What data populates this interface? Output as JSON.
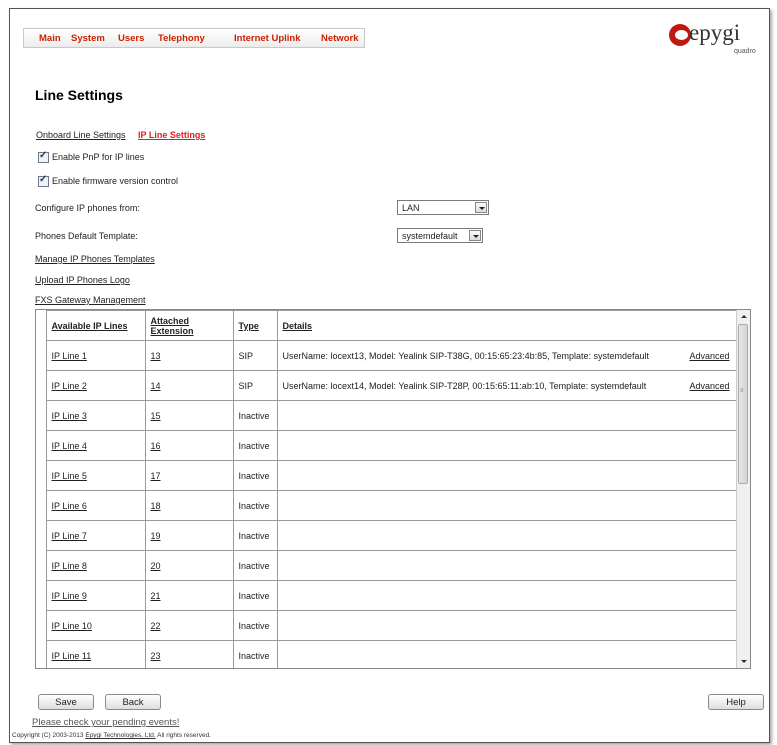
{
  "nav": {
    "items": [
      "Main",
      "System",
      "Users",
      "Telephony",
      "Internet Uplink",
      "Network"
    ]
  },
  "logo": {
    "word": "epygi",
    "sub": "quadro"
  },
  "page_title": "Line Settings",
  "subnav": {
    "onboard": "Onboard Line Settings",
    "ip": "IP Line Settings"
  },
  "checkboxes": {
    "pnp": "Enable PnP for IP lines",
    "firmware": "Enable firmware version control"
  },
  "configure": {
    "label": "Configure IP phones from:",
    "value": "LAN"
  },
  "template": {
    "label": "Phones Default Template:",
    "value": "systemdefault"
  },
  "links": {
    "manage": "Manage IP Phones Templates",
    "upload": "Upload IP Phones Logo",
    "fxs": "FXS Gateway Management"
  },
  "table": {
    "headers": [
      "Available IP Lines",
      "Attached Extension",
      "Type",
      "Details"
    ],
    "rows": [
      {
        "line": "IP Line 1",
        "ext": "13",
        "type": "SIP",
        "details": "UserName: locext13, Model: Yealink SIP-T38G, 00:15:65:23:4b:85, Template: systemdefault",
        "advanced": "Advanced"
      },
      {
        "line": "IP Line 2",
        "ext": "14",
        "type": "SIP",
        "details": "UserName: locext14, Model: Yealink SIP-T28P, 00:15:65:11:ab:10, Template: systemdefault",
        "advanced": "Advanced"
      },
      {
        "line": "IP Line 3",
        "ext": "15",
        "type": "Inactive",
        "details": "",
        "advanced": ""
      },
      {
        "line": "IP Line 4",
        "ext": "16",
        "type": "Inactive",
        "details": "",
        "advanced": ""
      },
      {
        "line": "IP Line 5",
        "ext": "17",
        "type": "Inactive",
        "details": "",
        "advanced": ""
      },
      {
        "line": "IP Line 6",
        "ext": "18",
        "type": "Inactive",
        "details": "",
        "advanced": ""
      },
      {
        "line": "IP Line 7",
        "ext": "19",
        "type": "Inactive",
        "details": "",
        "advanced": ""
      },
      {
        "line": "IP Line 8",
        "ext": "20",
        "type": "Inactive",
        "details": "",
        "advanced": ""
      },
      {
        "line": "IP Line 9",
        "ext": "21",
        "type": "Inactive",
        "details": "",
        "advanced": ""
      },
      {
        "line": "IP Line 10",
        "ext": "22",
        "type": "Inactive",
        "details": "",
        "advanced": ""
      },
      {
        "line": "IP Line 11",
        "ext": "23",
        "type": "Inactive",
        "details": "",
        "advanced": ""
      }
    ]
  },
  "buttons": {
    "save": "Save",
    "back": "Back",
    "help": "Help"
  },
  "pending": "Please check your pending events!",
  "copyright": {
    "pre": "Copyright (C) 2003-2013 ",
    "company": "Epygi Technologies, Ltd.",
    "post": " All rights reserved."
  }
}
